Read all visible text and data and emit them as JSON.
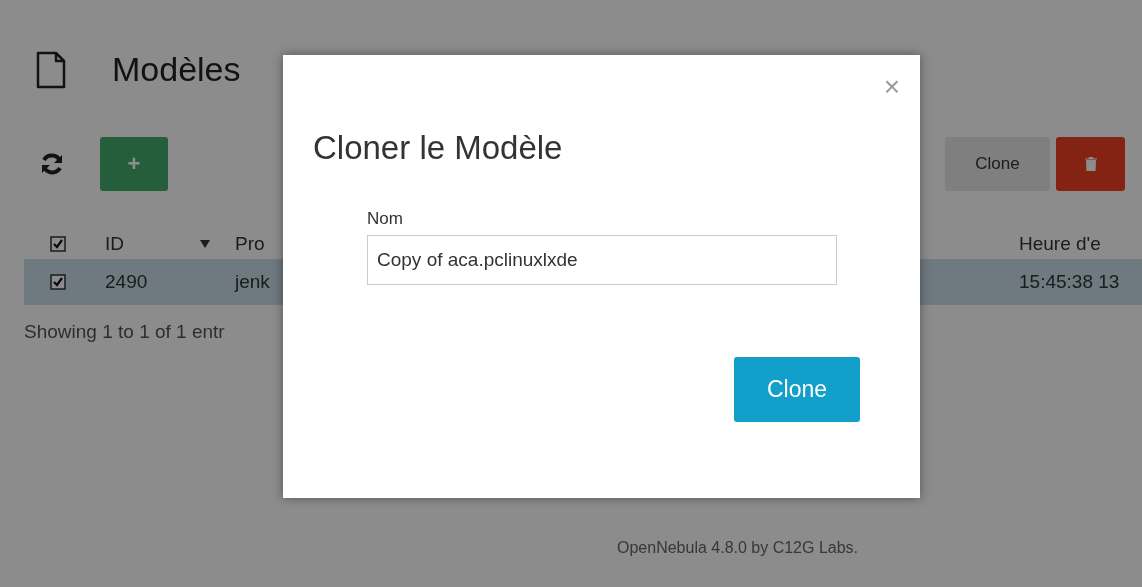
{
  "page": {
    "title": "Modèles",
    "toolbar": {
      "add_button": "+",
      "clone_button": "Clone"
    },
    "table": {
      "header_checked": true,
      "columns": [
        "ID",
        "Pro"
      ],
      "right_column": "Heure d'e",
      "rows": [
        {
          "checked": true,
          "selected": true,
          "cells": [
            "2490",
            "jenk"
          ],
          "right_cell": "15:45:38 13"
        }
      ]
    },
    "info": "Showing 1 to 1 of 1 entr",
    "footer": "OpenNebula 4.8.0 by C12G Labs."
  },
  "dialog": {
    "close": "×",
    "title": "Cloner le Modèle",
    "field": {
      "label": "Nom",
      "value": "Copy of aca.pclinuxlxde"
    },
    "button": "Clone"
  }
}
